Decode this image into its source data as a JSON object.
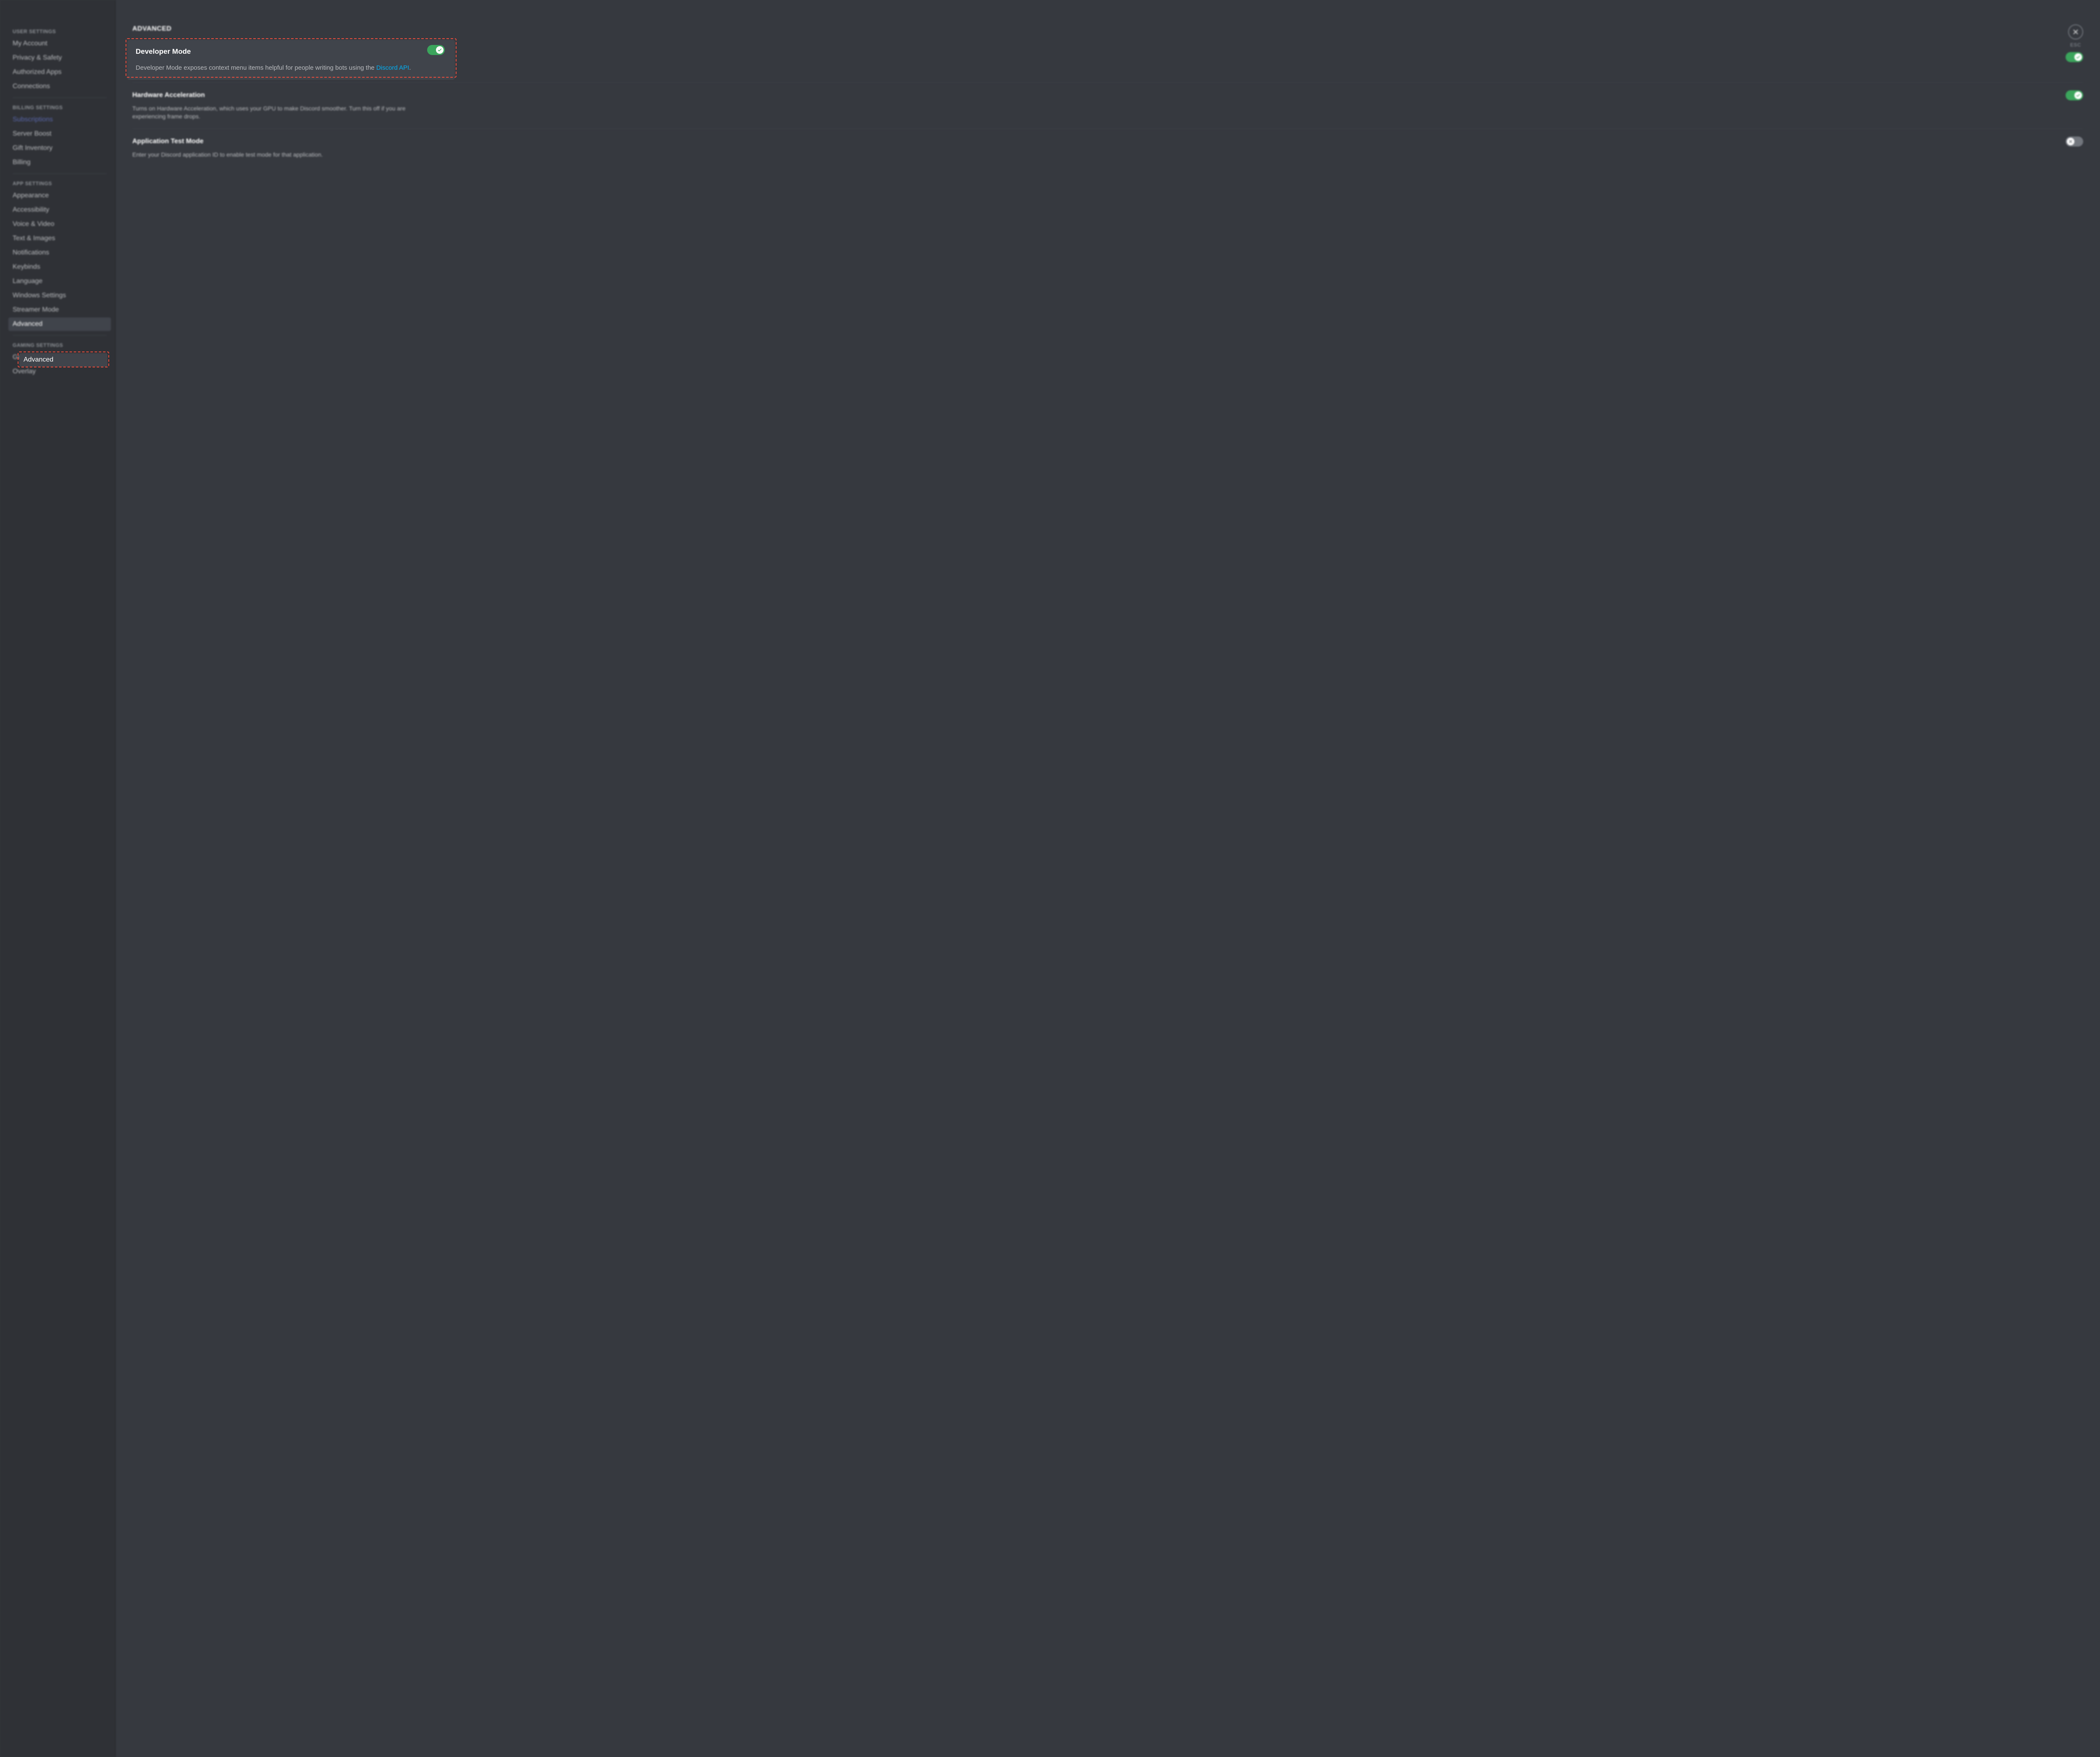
{
  "sidebar": {
    "sections": [
      {
        "header": "USER SETTINGS",
        "items": [
          {
            "label": "My Account"
          },
          {
            "label": "Privacy & Safety"
          },
          {
            "label": "Authorized Apps"
          },
          {
            "label": "Connections"
          }
        ]
      },
      {
        "header": "BILLING SETTINGS",
        "items": [
          {
            "label": "Subscriptions",
            "link": true
          },
          {
            "label": "Server Boost"
          },
          {
            "label": "Gift Inventory"
          },
          {
            "label": "Billing"
          }
        ]
      },
      {
        "header": "APP SETTINGS",
        "items": [
          {
            "label": "Appearance"
          },
          {
            "label": "Accessibility"
          },
          {
            "label": "Voice & Video"
          },
          {
            "label": "Text & Images"
          },
          {
            "label": "Notifications"
          },
          {
            "label": "Keybinds"
          },
          {
            "label": "Language"
          },
          {
            "label": "Windows Settings"
          },
          {
            "label": "Streamer Mode"
          },
          {
            "label": "Advanced",
            "active": true
          }
        ]
      },
      {
        "header": "GAMING SETTINGS",
        "items": [
          {
            "label": "Game Activity"
          },
          {
            "label": "Overlay"
          }
        ]
      }
    ]
  },
  "main": {
    "title": "ADVANCED",
    "settings": [
      {
        "title": "Developer Mode",
        "desc_before": "Developer Mode exposes context menu items helpful for people writing bots using the ",
        "desc_link": "Discord API",
        "desc_after": ".",
        "enabled": true
      },
      {
        "title": "Hardware Acceleration",
        "desc": "Turns on Hardware Acceleration, which uses your GPU to make Discord smoother. Turn this off if you are experiencing frame drops.",
        "enabled": true
      },
      {
        "title": "Application Test Mode",
        "desc": "Enter your Discord application ID to enable test mode for that application.",
        "enabled": false
      }
    ]
  },
  "close": {
    "label": "ESC"
  },
  "highlight": {
    "sidebar_item": "Advanced",
    "panel": {
      "title": "Developer Mode",
      "desc_before": "Developer Mode exposes context menu items helpful for people writing bots using the ",
      "desc_link": "Discord API",
      "desc_after": "."
    }
  }
}
